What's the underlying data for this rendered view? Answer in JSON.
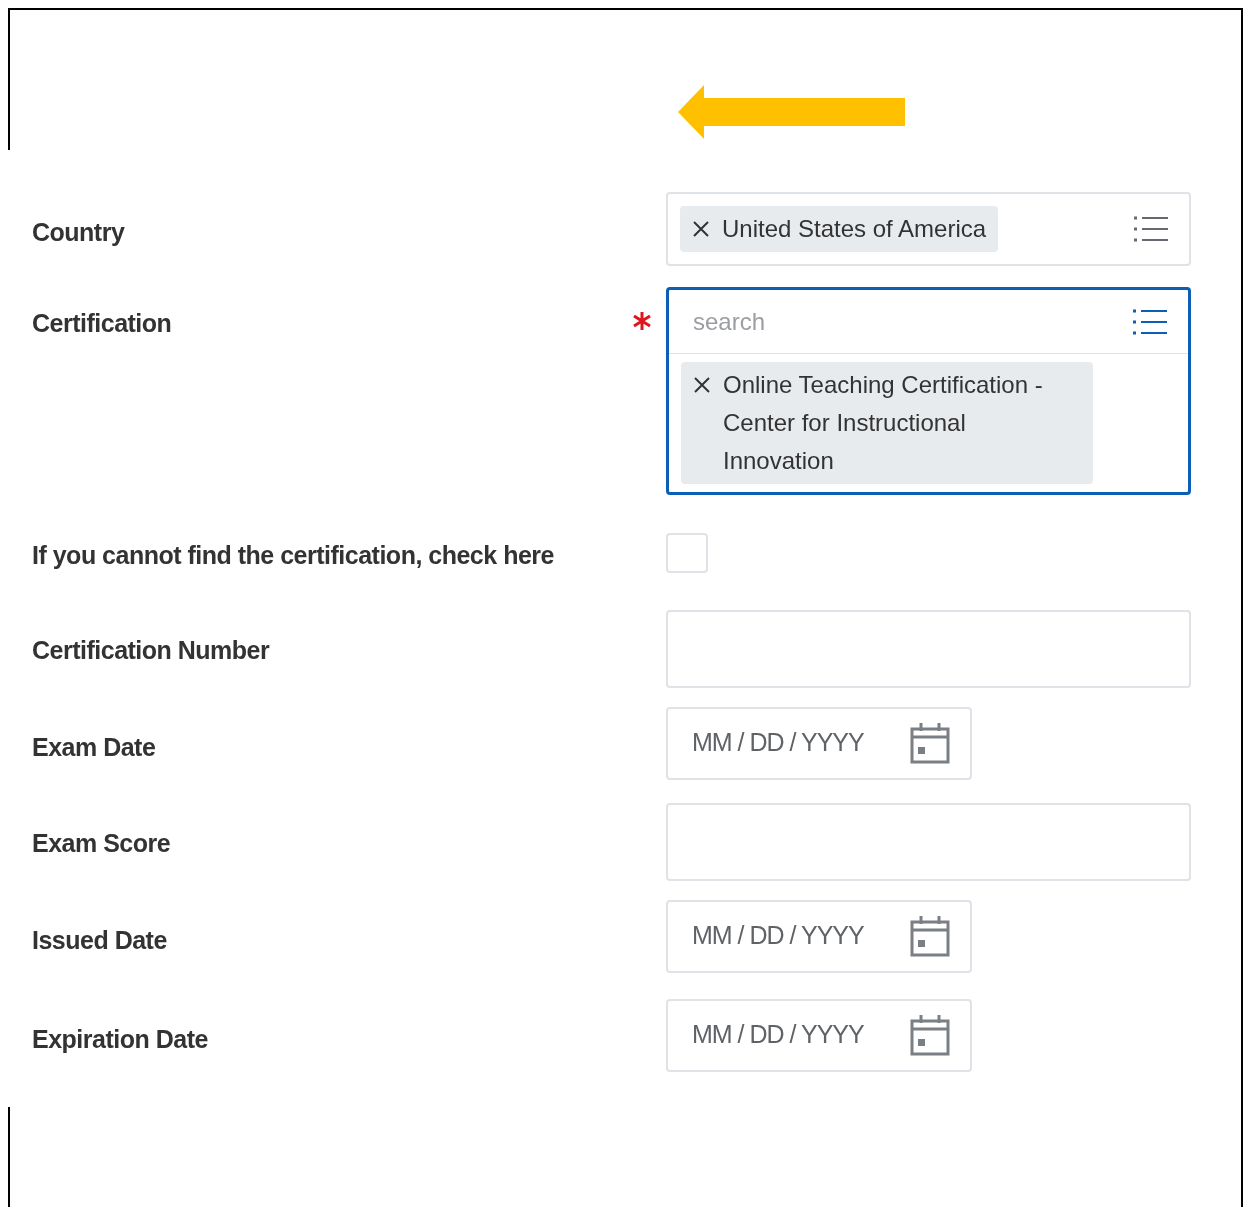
{
  "fields": [
    {
      "label": "Country",
      "kind": "select",
      "required": false,
      "focused": false,
      "chips": [
        "United States of America"
      ]
    },
    {
      "label": "Certification",
      "kind": "select",
      "required": true,
      "focused": true,
      "placeholder": "search",
      "chips": [
        "Online Teaching Certification - Center for Instructional Innovation"
      ]
    },
    {
      "label": "If you cannot find the certification, check here",
      "kind": "checkbox",
      "required": false,
      "focused": false,
      "checked": false
    },
    {
      "label": "Certification Number",
      "kind": "text",
      "required": false,
      "focused": false
    },
    {
      "label": "Exam Date",
      "kind": "date",
      "required": false,
      "focused": false,
      "placeholder": "MM / DD / YYYY"
    },
    {
      "label": "Exam Score",
      "kind": "text",
      "required": false,
      "focused": false
    },
    {
      "label": "Issued Date",
      "kind": "date",
      "required": false,
      "focused": false,
      "placeholder": "MM / DD / YYYY"
    },
    {
      "label": "Expiration Date",
      "kind": "date",
      "required": false,
      "focused": false,
      "placeholder": "MM / DD / YYYY"
    }
  ]
}
